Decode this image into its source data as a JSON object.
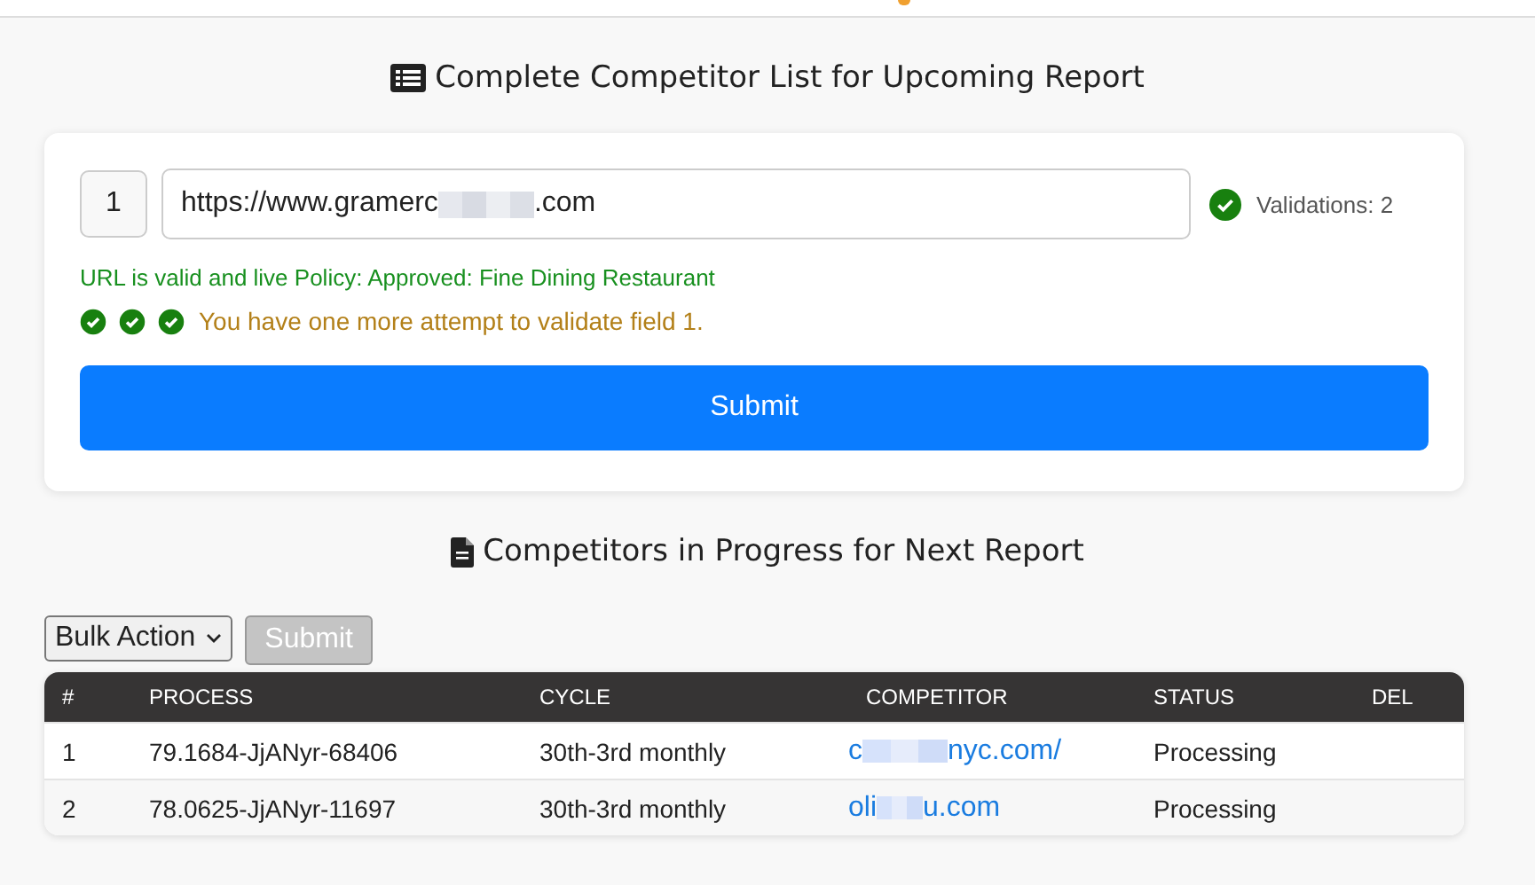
{
  "title": "Complete Competitor List for Upcoming Report",
  "form": {
    "index": "1",
    "url_prefix": "https://www.gramerc",
    "url_suffix": ".com",
    "validated": true,
    "validations": "Validations: 2",
    "status_message": "URL is valid and live Policy: Approved: Fine Dining Restaurant",
    "checks": [
      {
        "passed": true
      },
      {
        "passed": true
      },
      {
        "passed": true
      }
    ],
    "attempt_message": "You have one more attempt to validate field 1.",
    "submit": "Submit"
  },
  "progress_title": "Competitors in Progress for Next Report",
  "bulk_action": "Bulk Action",
  "bulk_submit": {
    "label": "Submit",
    "disabled": true
  },
  "table": {
    "columns": [
      "#",
      "PROCESS",
      "CYCLE",
      "COMPETITOR",
      "STATUS",
      "DEL"
    ],
    "rows": [
      {
        "num": "1",
        "process": "79.1684-JjANyr-68406",
        "cycle": "30th-3rd monthly",
        "competitor_prefix": "c",
        "competitor_suffix": "nyc.com/",
        "status": "Processing"
      },
      {
        "num": "2",
        "process": "78.0625-JjANyr-11697",
        "cycle": "30th-3rd monthly",
        "competitor_prefix": "oli",
        "competitor_suffix": "u.com",
        "status": "Processing"
      }
    ]
  }
}
